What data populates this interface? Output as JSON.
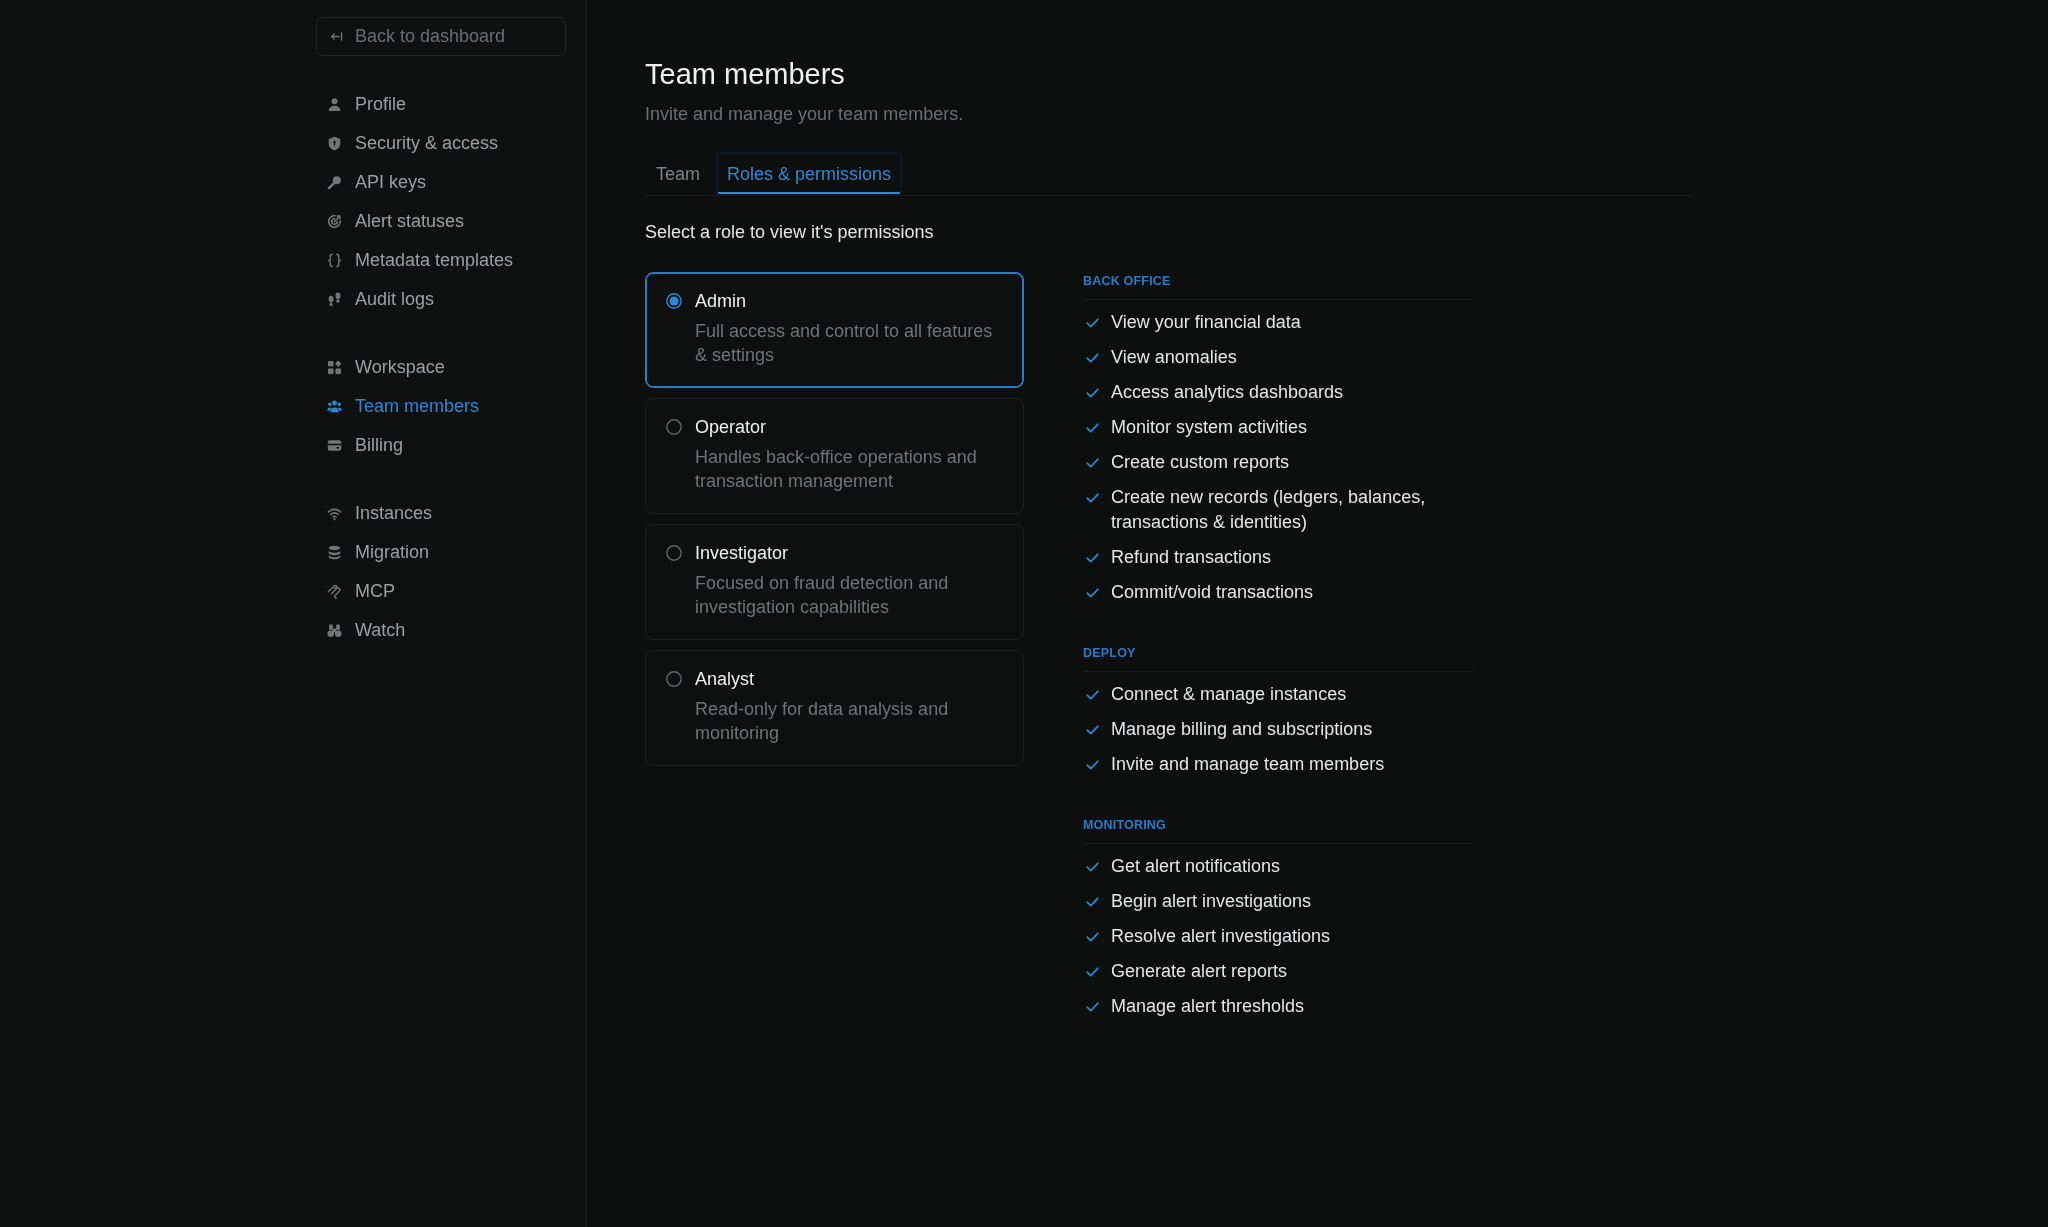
{
  "sidebar": {
    "back_button": {
      "label": "Back to dashboard"
    },
    "sections": [
      {
        "items": [
          {
            "label": "Profile",
            "selected": false
          },
          {
            "label": "Security & access",
            "selected": false
          },
          {
            "label": "API keys",
            "selected": false
          },
          {
            "label": "Alert statuses",
            "selected": false
          },
          {
            "label": "Metadata templates",
            "selected": false
          },
          {
            "label": "Audit logs",
            "selected": false
          }
        ]
      },
      {
        "items": [
          {
            "label": "Workspace",
            "selected": false
          },
          {
            "label": "Team members",
            "selected": true
          },
          {
            "label": "Billing",
            "selected": false
          }
        ]
      },
      {
        "items": [
          {
            "label": "Instances",
            "selected": false
          },
          {
            "label": "Migration",
            "selected": false
          },
          {
            "label": "MCP",
            "selected": false
          },
          {
            "label": "Watch",
            "selected": false
          }
        ]
      }
    ]
  },
  "page": {
    "title": "Team members",
    "subtitle": "Invite and manage your team members."
  },
  "tabs": [
    {
      "label": "Team",
      "selected": false
    },
    {
      "label": "Roles & permissions",
      "selected": true
    }
  ],
  "role_picker": {
    "prompt": "Select a role to view it's permissions",
    "roles": [
      {
        "name": "Admin",
        "description": "Full access and control to all features & settings",
        "selected": true
      },
      {
        "name": "Operator",
        "description": "Handles back-office operations and transaction management",
        "selected": false
      },
      {
        "name": "Investigator",
        "description": "Focused on fraud detection and investigation capabilities",
        "selected": false
      },
      {
        "name": "Analyst",
        "description": "Read-only for data analysis and monitoring",
        "selected": false
      }
    ]
  },
  "permission_groups": [
    {
      "heading": "BACK OFFICE",
      "items": [
        {
          "label": "View your financial data",
          "checked": true
        },
        {
          "label": "View anomalies",
          "checked": true
        },
        {
          "label": "Access analytics dashboards",
          "checked": true
        },
        {
          "label": "Monitor system activities",
          "checked": true
        },
        {
          "label": "Create custom reports",
          "checked": true
        },
        {
          "label": "Create new records (ledgers, balances, transactions & identities)",
          "checked": true
        },
        {
          "label": "Refund transactions",
          "checked": true
        },
        {
          "label": "Commit/void transactions",
          "checked": true
        }
      ]
    },
    {
      "heading": "DEPLOY",
      "items": [
        {
          "label": "Connect & manage instances",
          "checked": true
        },
        {
          "label": "Manage billing and subscriptions",
          "checked": true
        },
        {
          "label": "Invite and manage team members",
          "checked": true
        }
      ]
    },
    {
      "heading": "MONITORING",
      "items": [
        {
          "label": "Get alert notifications",
          "checked": true
        },
        {
          "label": "Begin alert investigations",
          "checked": true
        },
        {
          "label": "Resolve alert investigations",
          "checked": true
        },
        {
          "label": "Generate alert reports",
          "checked": true
        },
        {
          "label": "Manage alert thresholds",
          "checked": true
        }
      ]
    }
  ]
}
